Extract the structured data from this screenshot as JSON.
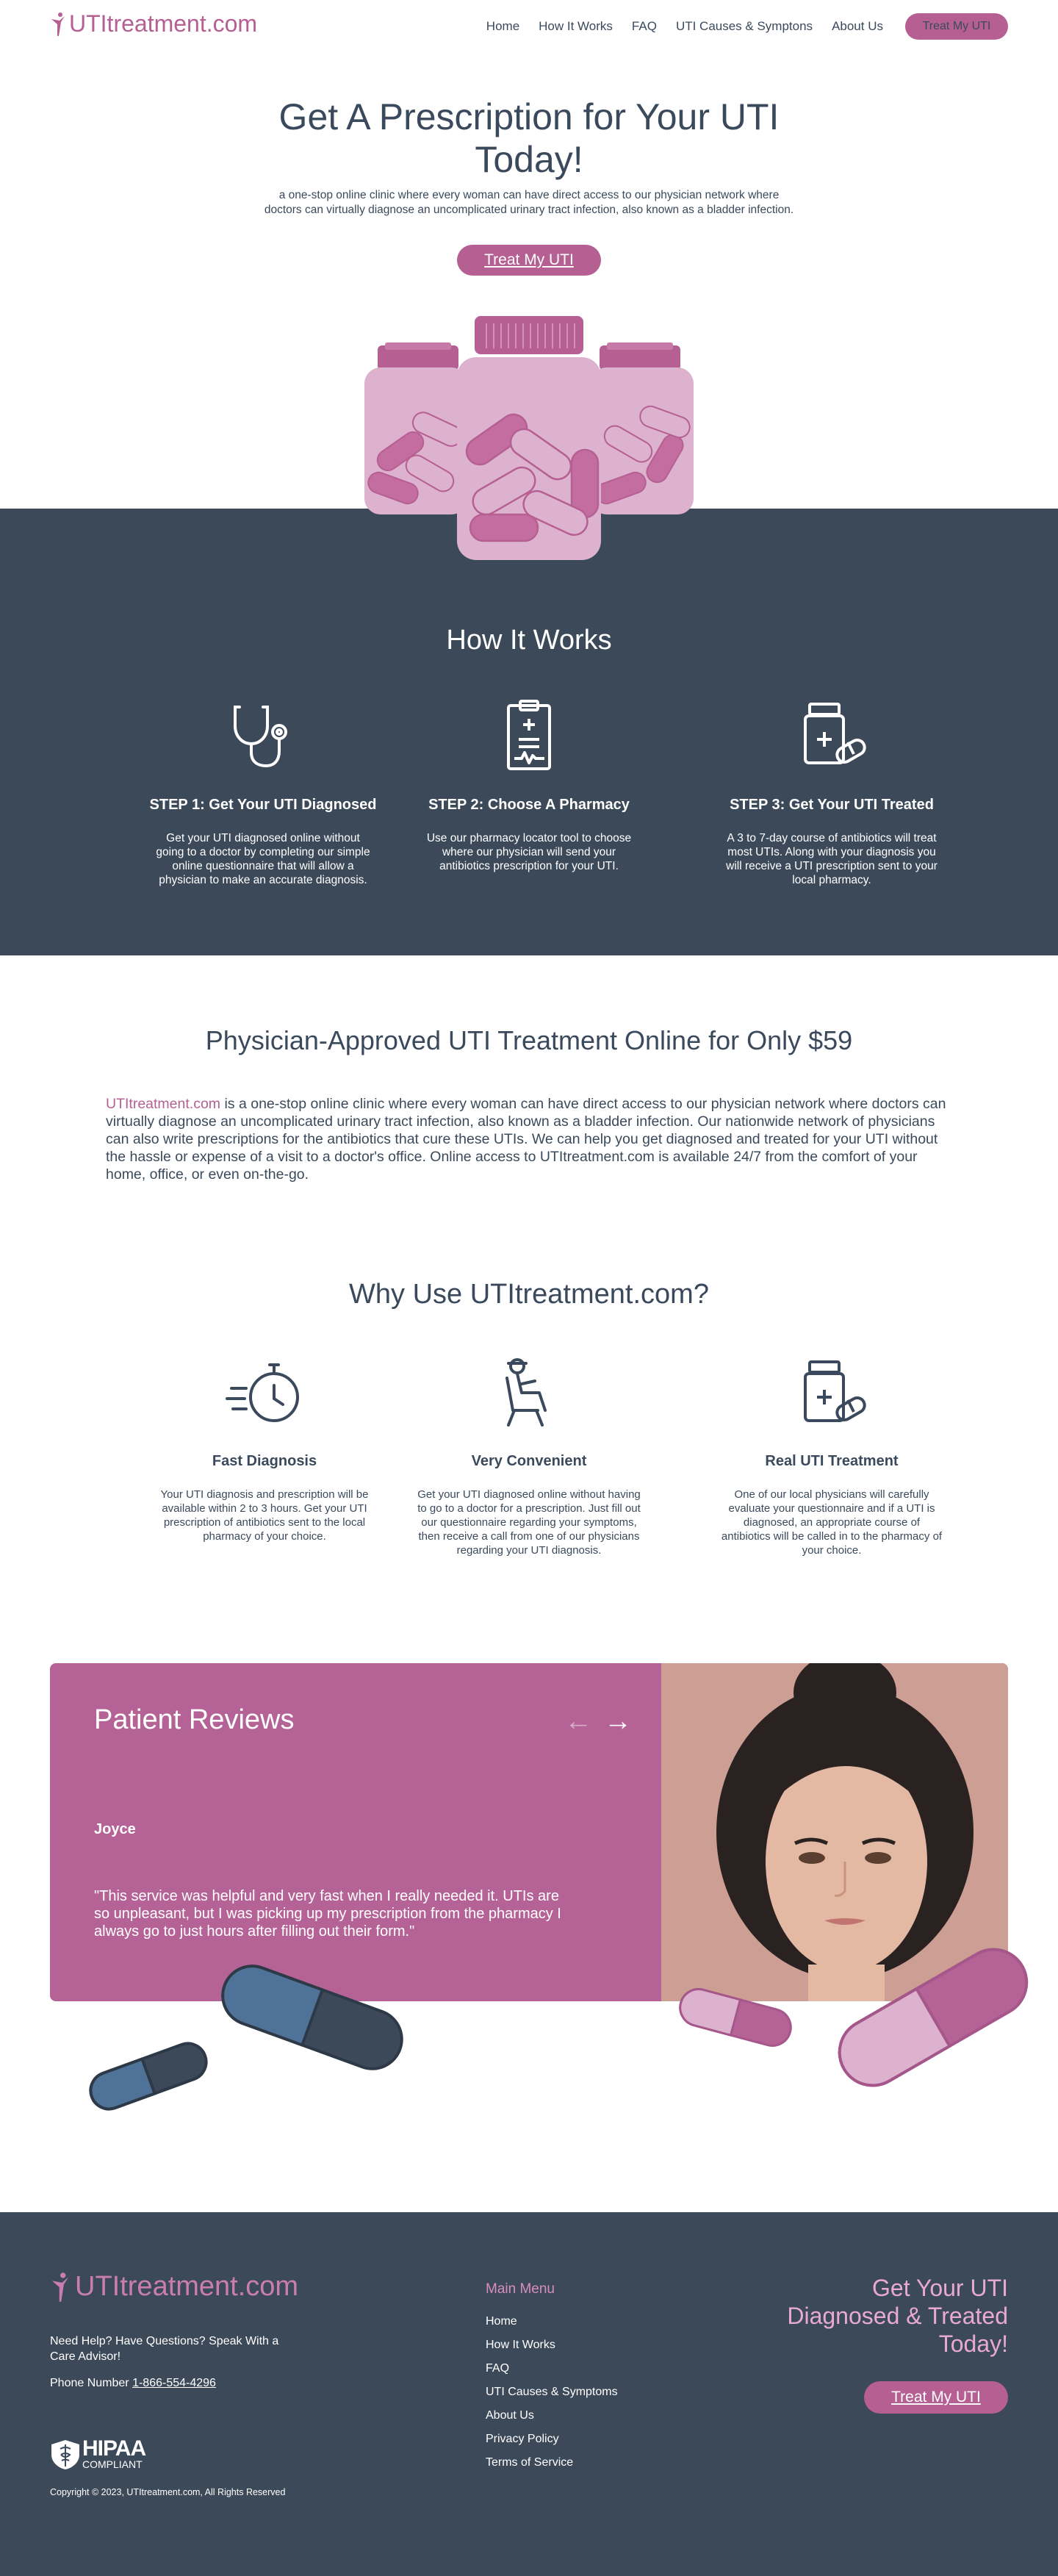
{
  "header": {
    "logo_uti": "UTI",
    "logo_rest": "treatment.com",
    "nav": [
      "Home",
      "How It Works",
      "FAQ",
      "UTI Causes & Symptons",
      "About Us"
    ],
    "cta": "Treat My UTI"
  },
  "hero": {
    "title": "Get A Prescription for Your UTI Today!",
    "subtitle": "a one-stop online clinic where every woman can have direct access to our physician network where doctors can virtually diagnose an uncomplicated urinary tract infection, also known as a bladder infection.",
    "button": "Treat My UTI"
  },
  "how": {
    "title": "How It Works",
    "steps": [
      {
        "icon": "stethoscope-icon",
        "title": "STEP 1: Get Your UTI Diagnosed",
        "text": "Get your UTI diagnosed online without going to a doctor by completing our simple online questionnaire that will allow a physician to make an accurate diagnosis."
      },
      {
        "icon": "clipboard-icon",
        "title": "STEP 2: Choose A Pharmacy",
        "text": "Use our pharmacy locator tool to choose where our physician will send your antibiotics prescription for your UTI."
      },
      {
        "icon": "medicine-bottle-icon",
        "title": "STEP 3: Get Your UTI Treated",
        "text": "A 3 to 7-day course of antibiotics will treat most UTIs. Along with your diagnosis you will receive a UTI prescription sent to your local pharmacy."
      }
    ]
  },
  "physician": {
    "title": "Physician-Approved UTI Treatment Online for Only $59",
    "brand": "UTItreatment.com",
    "body": " is a one-stop online clinic where every woman can have direct access to our physician network where doctors can virtually diagnose an uncomplicated urinary tract infection, also known as a bladder infection. Our nationwide network of physicians can also write prescriptions for the antibiotics that cure these UTIs. We can help you get diagnosed and treated for your UTI without the hassle or expense of a visit to a doctor's office. Online access to UTItreatment.com is available 24/7 from the comfort of your home, office, or even on-the-go."
  },
  "why": {
    "title": "Why Use UTItreatment.com?",
    "items": [
      {
        "icon": "fast-timer-icon",
        "title": "Fast Diagnosis",
        "text": "Your UTI diagnosis and prescription will be available within 2 to 3 hours. Get your UTI prescription of antibiotics sent to the local pharmacy of your choice."
      },
      {
        "icon": "relaxing-chair-icon",
        "title": "Very Convenient",
        "text": "Get your UTI diagnosed online without having to go to a doctor for a prescription. Just fill out our questionnaire regarding your symptoms, then receive a call from one of our physicians regarding your UTI diagnosis."
      },
      {
        "icon": "medicine-bottle-icon",
        "title": "Real UTI Treatment",
        "text": "One of our local physicians will carefully evaluate your questionnaire and if a UTI is diagnosed, an appropriate course of antibiotics will be called in to the pharmacy of your choice."
      }
    ]
  },
  "reviews": {
    "title": "Patient Reviews",
    "name": "Joyce",
    "text": "\"This service was helpful and very fast when I really needed it. UTIs are so unpleasant, but I was picking up my prescription from the pharmacy I always go to just hours after filling out their form.\""
  },
  "footer": {
    "logo_uti": "UTI",
    "logo_rest": "treatment.com",
    "help": "Need Help? Have Questions? Speak With a Care Advisor!",
    "phone_label": "Phone Number ",
    "phone": "1-866-554-4296",
    "hipaa_1": "HIPAA",
    "hipaa_2": "COMPLIANT",
    "copyright": "Copyright © 2023, UTItreatment.com, All Rights Reserved",
    "menu_title": "Main Menu",
    "menu": [
      "Home",
      "How It Works",
      "FAQ",
      "UTI Causes & Symptoms",
      "About Us",
      "Privacy Policy",
      "Terms of Service"
    ],
    "cta_text": "Get Your UTI Diagnosed & Treated Today!",
    "cta_button": "Treat My UTI"
  },
  "colors": {
    "brand": "#b55f93",
    "dark": "#3c4959",
    "text": "#3a4a5c"
  }
}
